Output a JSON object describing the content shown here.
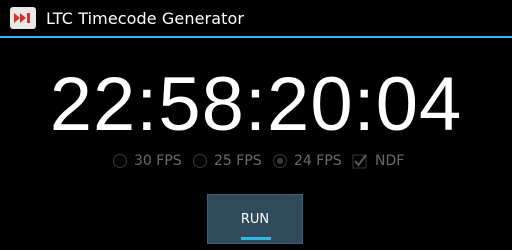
{
  "app": {
    "title": "LTC Timecode Generator",
    "icon": "fast-forward-icon",
    "accent_color": "#33b5e5"
  },
  "timecode": {
    "value": "22:58:20:04"
  },
  "options": {
    "fps_30": {
      "label": "30 FPS",
      "selected": false
    },
    "fps_25": {
      "label": "25 FPS",
      "selected": false
    },
    "fps_24": {
      "label": "24 FPS",
      "selected": true
    },
    "ndf": {
      "label": "NDF",
      "checked": true
    }
  },
  "run_button": {
    "label": "RUN"
  }
}
